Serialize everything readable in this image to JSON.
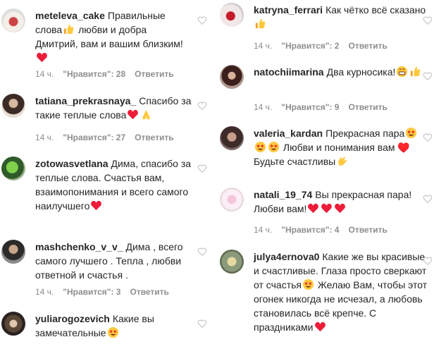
{
  "comments_left": [
    {
      "user": "meteleva_cake",
      "text_parts": [
        "Правильные слова",
        "thumb",
        " любви и добра Дмитрий, вам и вашим близким!",
        "heart"
      ],
      "time": "14 ч.",
      "likes": "\"Нравится\": 28",
      "reply": "Ответить"
    },
    {
      "user": "tatiana_prekrasnaya_",
      "text_parts": [
        "Спасибо за такие теплые слова",
        "heart",
        "pray"
      ],
      "time": "14 ч.",
      "likes": "\"Нравится\": 27",
      "reply": "Ответить"
    },
    {
      "user": "zotowasvetlana",
      "text_parts": [
        "Дима, спасибо за теплые слова. Счастья вам, взаимопонимания и всего самого наилучшего",
        "heart"
      ],
      "time": "",
      "likes": "",
      "reply": ""
    },
    {
      "user": "mashchenko_v_v_",
      "text_parts": [
        "Дима , всего самого лучшего . Тепла , любви ответной и счастья ."
      ],
      "time": "14 ч.",
      "likes": "\"Нравится\": 3",
      "reply": "Ответить"
    },
    {
      "user": "yuliarogozevich",
      "text_parts": [
        "Какие вы замечательные",
        "starstruck"
      ],
      "time": "",
      "likes": "",
      "reply": ""
    }
  ],
  "comments_right": [
    {
      "user": "katryna_ferrari",
      "text_parts": [
        "Как чётко всё сказано",
        "thumb"
      ],
      "time": "14 ч.",
      "likes": "\"Нравится\": 2",
      "reply": "Ответить"
    },
    {
      "user": "natochiimarina",
      "text_parts": [
        "Два курносика!",
        "grin",
        "thumb"
      ],
      "time": "14 ч.",
      "likes": "\"Нравится\": 9",
      "reply": "Ответить"
    },
    {
      "user": "valeria_kardan",
      "text_parts": [
        "Прекрасная пара",
        "starstruck",
        "starstruck",
        "starstruck",
        " Любви и понимания вам ♥️ Будьте счастливы",
        "clap"
      ],
      "time": "",
      "likes": "",
      "reply": ""
    },
    {
      "user": "natali_19_74",
      "text_parts": [
        "Вы прекрасная пара! Любви вам!",
        "heart",
        "heart",
        "heart"
      ],
      "time": "14 ч.",
      "likes": "\"Нравится\": 4",
      "reply": "Ответить"
    },
    {
      "user": "julya4ernova0",
      "text_parts": [
        "Какие же вы красивые и счастливые. Глаза просто сверкают от счастья",
        "starstruck",
        " Желаю Вам, чтобы этот огонек никогда не исчезал, а любовь становилась всё крепче. С праздниками",
        "heart"
      ],
      "time": "",
      "likes": "",
      "reply": ""
    }
  ],
  "colors": {
    "text": "#262626",
    "meta": "#8e8e8e",
    "heart_emoji": "#ed1c3a",
    "yellow_emoji": "#ffc83d"
  }
}
